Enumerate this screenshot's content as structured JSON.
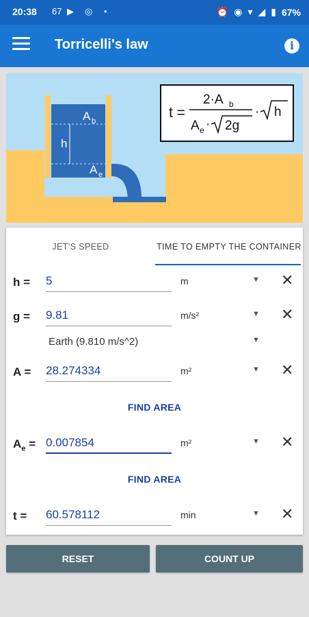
{
  "status": {
    "time": "20:38",
    "notif_count": "67",
    "battery": "67%"
  },
  "appbar": {
    "title": "Torricelli's law"
  },
  "illustration": {
    "label_ab": "A",
    "label_ab_sub": "b",
    "label_h": "h",
    "label_ae": "A",
    "label_ae_sub": "e",
    "formula_t": "t =",
    "formula_num": "2·A",
    "formula_num_sub": "b",
    "formula_den_a": "A",
    "formula_den_sub": "e",
    "formula_den_rest": "·",
    "formula_den_root": "2g",
    "formula_dot": "·",
    "formula_root": "h"
  },
  "tabs": [
    {
      "label": "JET'S SPEED",
      "selected": false
    },
    {
      "label": "TIME TO EMPTY THE CONTAINER",
      "selected": true
    }
  ],
  "rows": {
    "h": {
      "label": "h =",
      "value": "5",
      "unit": "m"
    },
    "g": {
      "label": "g =",
      "value": "9.81",
      "unit": "m/s²",
      "preset": "Earth (9.810 m/s^2)"
    },
    "a": {
      "label": "A =",
      "value": "28.274334",
      "unit": "m²"
    },
    "ae": {
      "label": "A",
      "label_sub": "e",
      "label_eq": " =",
      "value": "0.007854",
      "unit": "m²"
    },
    "t": {
      "label": "t =",
      "value": "60.578112",
      "unit": "min"
    }
  },
  "find_area_label": "FIND AREA",
  "buttons": {
    "reset": "RESET",
    "count_up": "COUNT UP"
  },
  "colors": {
    "primary": "#1976d2",
    "status_bar": "#1565c0",
    "button": "#546e7a",
    "sky": "#b3def5",
    "ground": "#ffca62",
    "water": "#2f6db8"
  }
}
